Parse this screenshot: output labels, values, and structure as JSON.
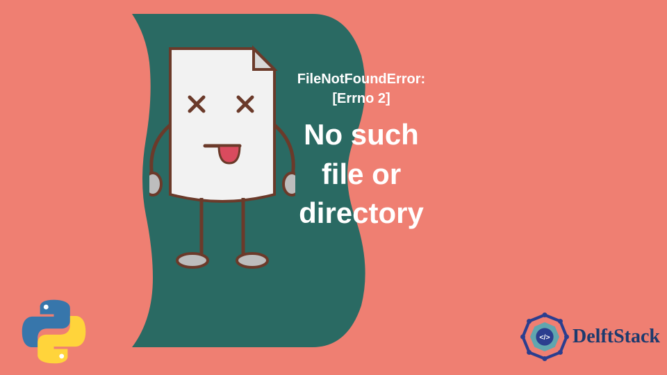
{
  "error": {
    "title": "FileNotFoundError:",
    "errno": "[Errno 2]",
    "message_line1": "No such",
    "message_line2": "file or",
    "message_line3": "directory"
  },
  "brand": {
    "name": "DelftStack"
  },
  "icons": {
    "python": "python-logo",
    "file_character": "dead-file-character",
    "delft_logo": "delftstack-logo"
  },
  "colors": {
    "background": "#ef7f72",
    "teal": "#2a6a63",
    "file": "#f4f4f4",
    "brand_blue": "#1c3a6e",
    "tongue": "#d94b5e"
  }
}
